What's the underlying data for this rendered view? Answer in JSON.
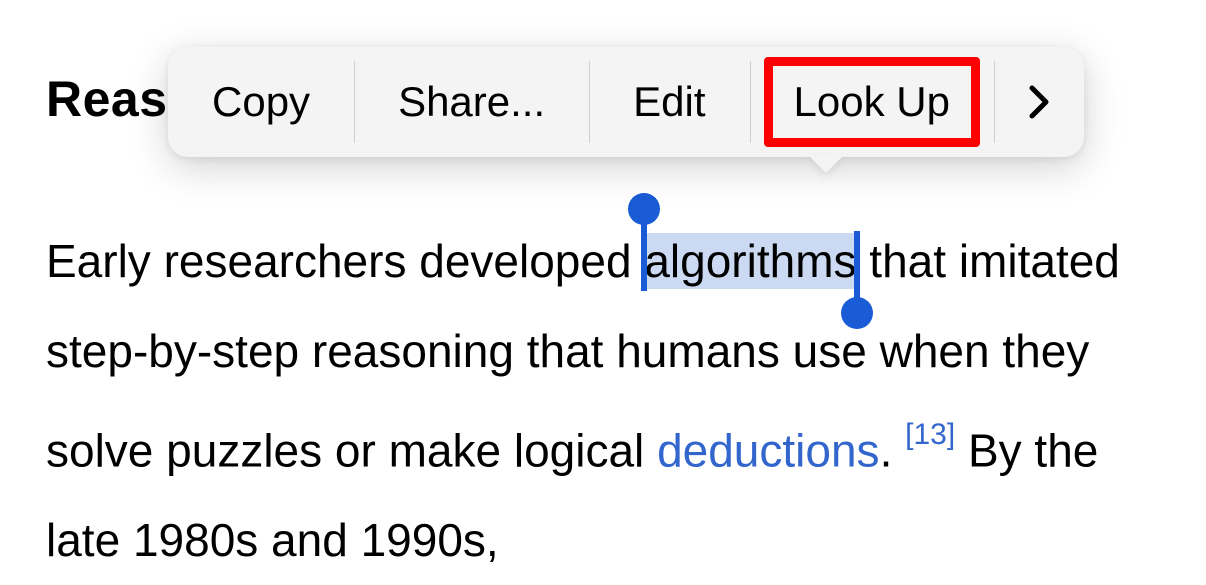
{
  "heading": "Reas",
  "context_menu": {
    "items": [
      {
        "label": "Copy"
      },
      {
        "label": "Share..."
      },
      {
        "label": "Edit"
      },
      {
        "label": "Look Up",
        "highlighted": true
      }
    ],
    "more_icon": "chevron-right"
  },
  "paragraph": {
    "pre": "Early researchers developed ",
    "selected": "algorithms",
    "post1": " that imitated step-by-step reasoning that humans use when they solve puzzles or make logical ",
    "link": "deductions",
    "post2": ". ",
    "ref": "[13]",
    "post3": " By the late 1980s and 1990s,"
  },
  "colors": {
    "selection_bg": "#cbd9f2",
    "selection_handle": "#1a5bd6",
    "link": "#3366cc",
    "highlight_border": "#ff0000"
  }
}
